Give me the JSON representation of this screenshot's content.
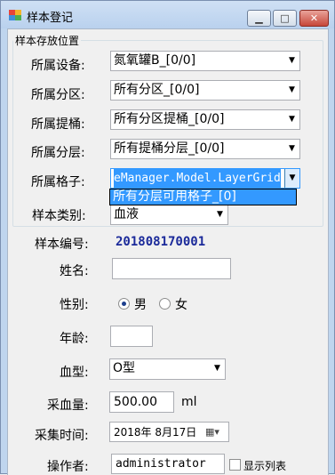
{
  "window": {
    "title": "样本登记",
    "minimize": "▁",
    "maximize": "□",
    "close": "✕"
  },
  "colors": {
    "selection": "#3399ff",
    "sample_no": "#1b2a9a",
    "icon": [
      "#e6443a",
      "#f3b42b",
      "#3f8fd9",
      "#4caf50"
    ]
  },
  "storage": {
    "group_title": "样本存放位置",
    "fields": [
      {
        "label": "所属设备:",
        "value": "氮氧罐B_[0/0]"
      },
      {
        "label": "所属分区:",
        "value": "所有分区_[0/0]"
      },
      {
        "label": "所属提桶:",
        "value": "所有分区提桶_[0/0]"
      },
      {
        "label": "所属分层:",
        "value": "所有提桶分层_[0/0]"
      },
      {
        "label": "所属格子:",
        "value": "eManager.Model.LayerGrid"
      }
    ],
    "dropdown_item": "所有分层可用格子_[0]"
  },
  "form": {
    "sample_type_label": "样本类别:",
    "sample_type_value": "血液",
    "sample_no_label": "样本编号:",
    "sample_no_value": "201808170001",
    "name_label": "姓名:",
    "name_value": "",
    "gender_label": "性别:",
    "gender_male": "男",
    "gender_female": "女",
    "age_label": "年龄:",
    "age_value": "",
    "blood_type_label": "血型:",
    "blood_type_value": "O型",
    "volume_label": "采血量:",
    "volume_value": "500.00",
    "volume_unit": "ml",
    "collect_time_label": "采集时间:",
    "collect_time_value": "2018年 8月17日",
    "operator_label": "操作者:",
    "operator_value": "administrator",
    "show_list_label": "显示列表"
  },
  "icons": {
    "dropdown_arrow": "▼",
    "calendar": "▦▾"
  }
}
